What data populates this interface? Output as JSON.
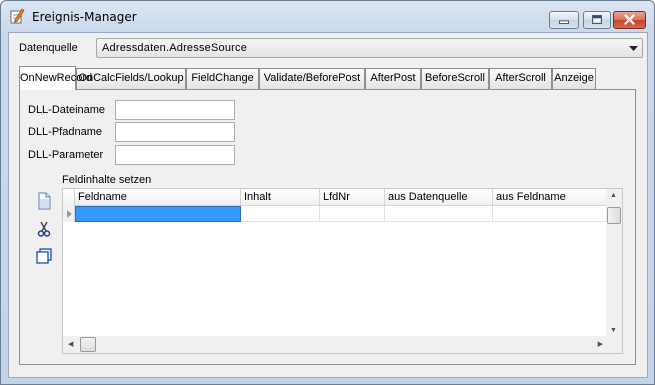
{
  "window": {
    "title": "Ereignis-Manager",
    "icon": "edit-pencil-icon",
    "buttons": {
      "minimize": "minimize-icon",
      "maximize": "maximize-icon",
      "close": "close-icon"
    }
  },
  "datasource": {
    "label": "Datenquelle",
    "value": "Adressdaten.AdresseSource"
  },
  "tabs": [
    {
      "label": "OnNewRecord",
      "active": true
    },
    {
      "label": "OnCalcFields/Lookup"
    },
    {
      "label": "FieldChange"
    },
    {
      "label": "Validate/BeforePost"
    },
    {
      "label": "AfterPost"
    },
    {
      "label": "BeforeScroll"
    },
    {
      "label": "AfterScroll"
    },
    {
      "label": "Anzeige"
    }
  ],
  "form": {
    "dll_file_label": "DLL-Dateiname",
    "dll_file_value": "",
    "dll_path_label": "DLL-Pfadname",
    "dll_path_value": "",
    "dll_param_label": "DLL-Parameter",
    "dll_param_value": ""
  },
  "fields": {
    "group_label": "Feldinhalte setzen",
    "columns": [
      "Feldname",
      "Inhalt",
      "LfdNr",
      "aus Datenquelle",
      "aus Feldname"
    ],
    "rows": [
      [
        "",
        "",
        "",
        "",
        ""
      ]
    ],
    "tools": [
      "new-document-icon",
      "cut-scissors-icon",
      "copy-icon"
    ]
  },
  "colors": {
    "selection": "#3399ff",
    "title_gradient_top": "#dbe6f3",
    "close_button": "#c5432b"
  }
}
